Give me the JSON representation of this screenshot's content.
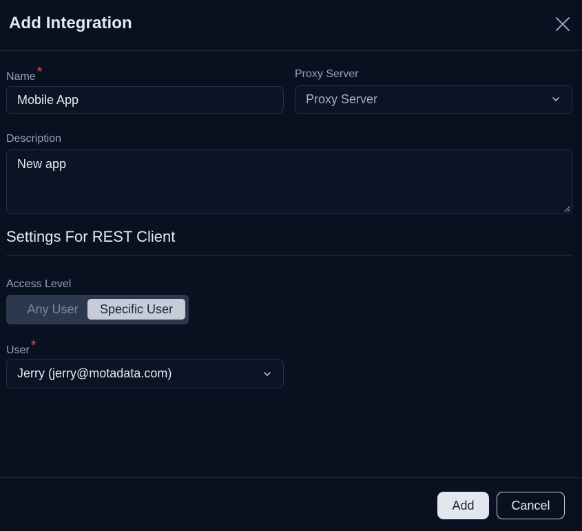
{
  "dialog": {
    "title": "Add Integration",
    "close_icon": "close-icon"
  },
  "form": {
    "name": {
      "label": "Name",
      "required": "*",
      "value": "Mobile App"
    },
    "proxy": {
      "label": "Proxy Server",
      "selected": "Proxy Server",
      "icon": "chevron-down-icon"
    },
    "description": {
      "label": "Description",
      "value": "New app"
    }
  },
  "rest_settings": {
    "title": "Settings For REST Client",
    "access_level": {
      "label": "Access Level",
      "options": [
        "Any User",
        "Specific User"
      ],
      "selected": "Specific User"
    },
    "user": {
      "label": "User",
      "required": "*",
      "selected": "Jerry (jerry@motadata.com)",
      "icon": "chevron-down-icon"
    }
  },
  "footer": {
    "add_label": "Add",
    "cancel_label": "Cancel"
  },
  "colors": {
    "background": "#091120",
    "required": "#ef4444",
    "active_toggle": "#c6cdd8"
  }
}
